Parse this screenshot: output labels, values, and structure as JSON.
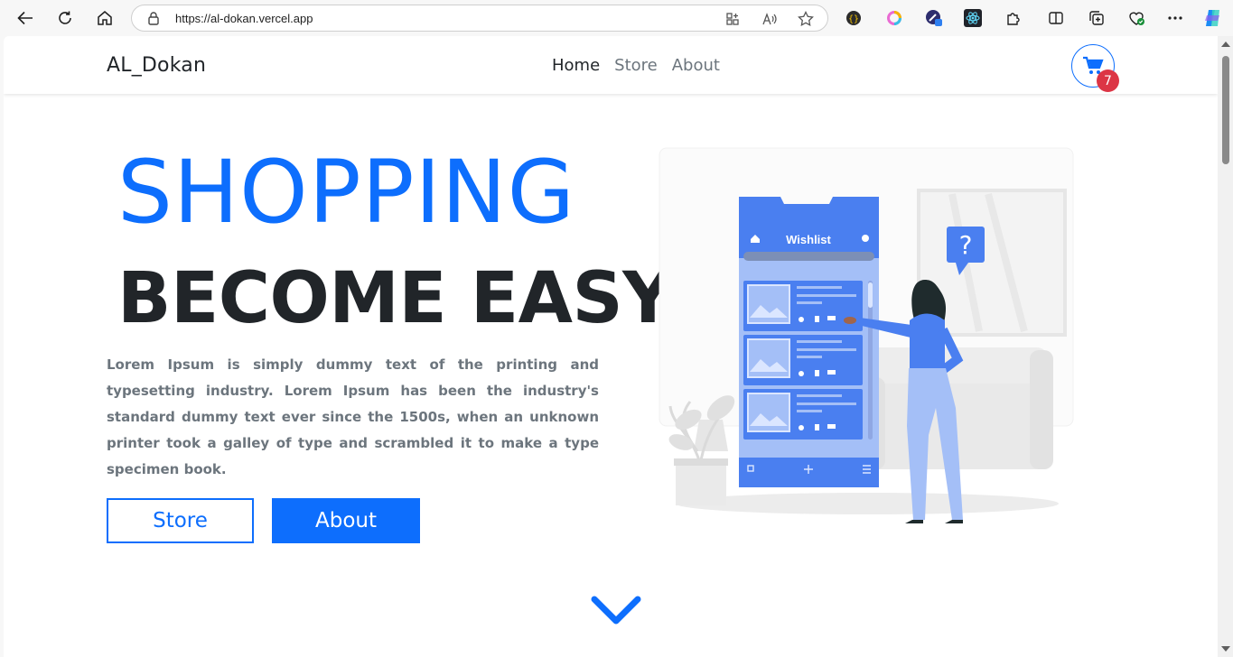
{
  "browser": {
    "url": "https://al-dokan.vercel.app"
  },
  "navbar": {
    "brand": "AL_Dokan",
    "links": [
      "Home",
      "Store",
      "About"
    ],
    "cart_count": "7"
  },
  "hero": {
    "title": "SHOPPING",
    "subtitle": "BECOME EASY",
    "description": "Lorem Ipsum is simply dummy text of the printing and typesetting industry. Lorem Ipsum has been the industry's standard dummy text ever since the 1500s, when an unknown printer took a galley of type and scrambled it to make a type specimen book.",
    "buttons": {
      "store": "Store",
      "about": "About"
    }
  },
  "illustration": {
    "wishlist_label": "Wishlist",
    "question_mark": "?"
  },
  "colors": {
    "primary": "#0d6efd",
    "dark": "#212529",
    "muted": "#6c757d",
    "badge": "#dc3545"
  }
}
